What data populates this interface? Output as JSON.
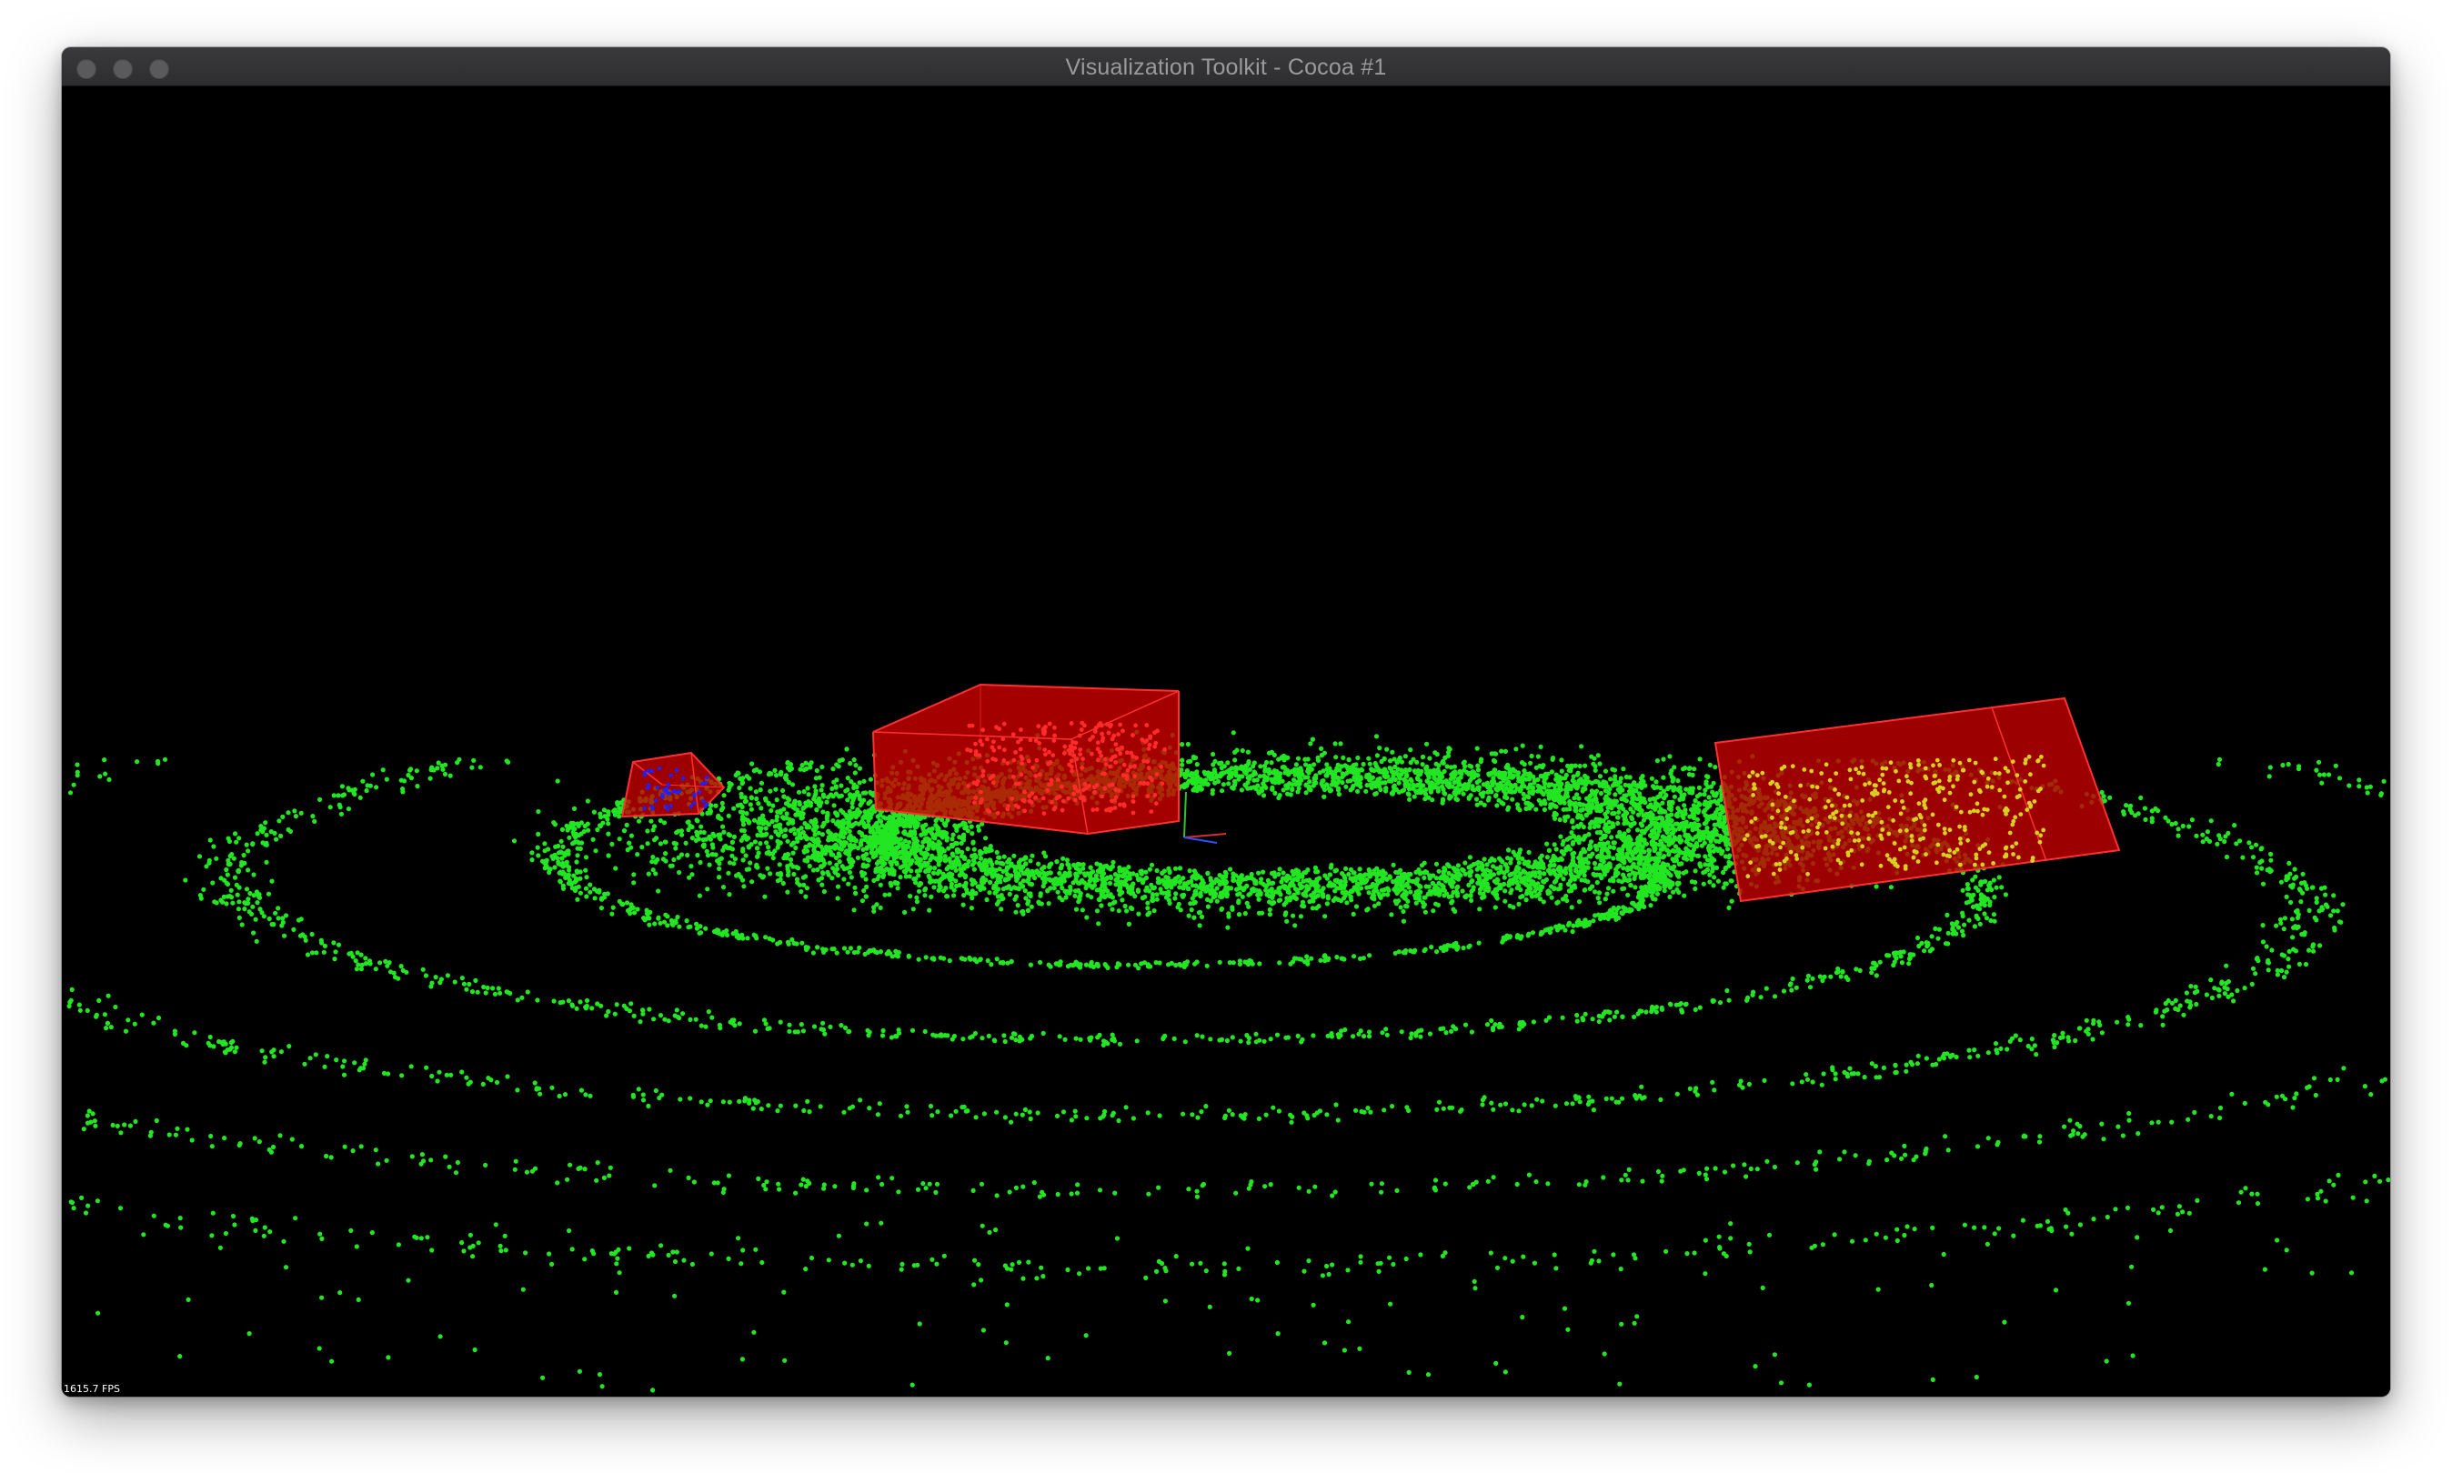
{
  "window": {
    "title": "Visualization Toolkit - Cocoa #1"
  },
  "viewport": {
    "fps_text": "1615.7 FPS",
    "background_color": "#000000",
    "scene_objects": [
      "galaxy-point-cloud",
      "bounding-box-small",
      "bounding-box-medium",
      "bounding-box-large",
      "axes-actor"
    ],
    "colors": {
      "points": "#22e622",
      "box_fill": "#cc0000",
      "box_edge": "#ff2020",
      "selected_points_red": "#ff2a2a",
      "selected_points_yellow": "#d8d020",
      "selected_points_blue": "#2020ff"
    }
  }
}
